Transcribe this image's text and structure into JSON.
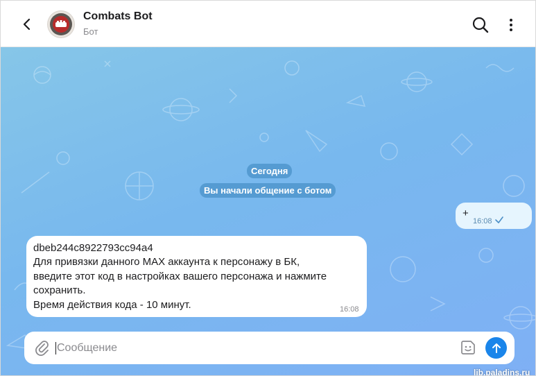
{
  "header": {
    "title": "Combats Bot",
    "subtitle": "Бот"
  },
  "chat": {
    "date_label": "Сегодня",
    "start_label": "Вы начали общение с ботом",
    "outgoing": {
      "text": "+",
      "time": "16:08",
      "status_icon": "check-icon"
    },
    "incoming": {
      "lines": [
        "dbeb244c8922793cc94a4",
        "Для привязки данного MAX аккаунта к персонажу в БК,",
        "введите этот код в настройках вашего персонажа и нажмите",
        "сохранить.",
        "Время действия кода - 10 минут."
      ],
      "time": "16:08"
    }
  },
  "composer": {
    "placeholder": "Сообщение",
    "value": ""
  },
  "watermark": "lib.paladins.ru",
  "colors": {
    "accent": "#1a85ea",
    "outgoing_bubble": "#e6f5fe",
    "incoming_bubble": "#ffffff",
    "chat_background": "#7fb8ef"
  }
}
